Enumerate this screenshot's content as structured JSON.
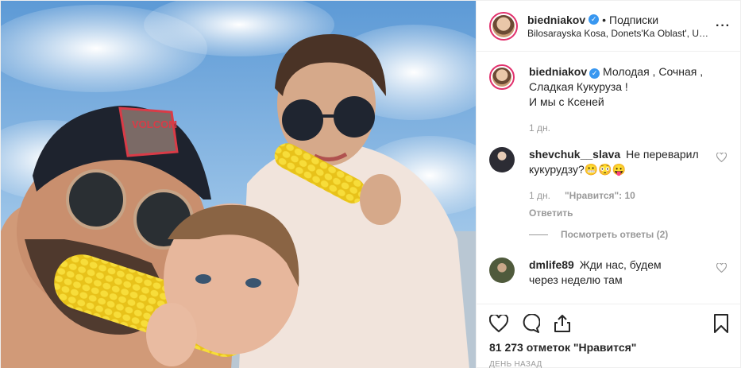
{
  "header": {
    "username": "biedniakov",
    "separator": "•",
    "follow_label": "Подписки",
    "location": "Bilosarayska Kosa, Donets'Ka Oblast', Ukraine",
    "more_label": "···"
  },
  "caption": {
    "username": "biedniakov",
    "text_line1": "Молодая , Сочная ,",
    "text_line2": "Сладкая Кукуруза !",
    "text_line3": "И мы с Ксеней",
    "time": "1 дн."
  },
  "comments": [
    {
      "username": "shevchuk__slava",
      "text_line1": "Не переварил",
      "text_line2": "кукурудзу?😬😳😛",
      "time": "1 дн.",
      "likes": "\"Нравится\": 10",
      "reply_label": "Ответить",
      "view_replies": "Посмотреть ответы (2)"
    },
    {
      "username": "dmlife89",
      "text_line1": "Жди нас, будем",
      "text_line2": "через неделю там"
    }
  ],
  "actions": {
    "likes_count": "81 273 отметок \"Нравится\"",
    "date": "ДЕНЬ НАЗАД"
  },
  "colors": {
    "accent": "#3897f0",
    "muted": "#999999",
    "text": "#262626"
  }
}
